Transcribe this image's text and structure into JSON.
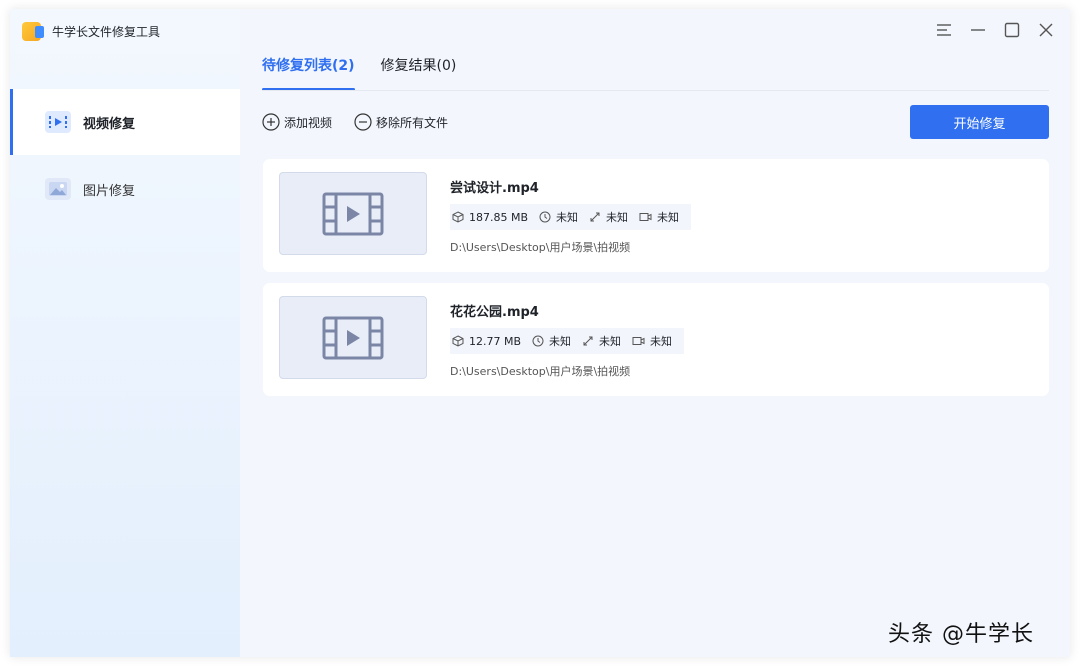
{
  "app": {
    "title": "牛学长文件修复工具"
  },
  "sidebar": {
    "items": [
      {
        "label": "视频修复",
        "icon": "video-repair-icon",
        "active": true
      },
      {
        "label": "图片修复",
        "icon": "image-repair-icon",
        "active": false
      }
    ]
  },
  "tabs": [
    {
      "label": "待修复列表(2)",
      "active": true
    },
    {
      "label": "修复结果(0)",
      "active": false
    }
  ],
  "toolbar": {
    "add_label": "添加视频",
    "remove_label": "移除所有文件",
    "start_label": "开始修复"
  },
  "files": [
    {
      "name": "尝试设计.mp4",
      "size": "187.85 MB",
      "duration": "未知",
      "resolution": "未知",
      "codec": "未知",
      "path": "D:\\Users\\Desktop\\用户场景\\拍视频"
    },
    {
      "name": "花花公园.mp4",
      "size": "12.77 MB",
      "duration": "未知",
      "resolution": "未知",
      "codec": "未知",
      "path": "D:\\Users\\Desktop\\用户场景\\拍视频"
    }
  ],
  "watermark": "头条 @牛学长",
  "colors": {
    "accent": "#2f6ff0",
    "sidebar_bg": "#e8f1fd",
    "main_bg": "#f3f7fd"
  }
}
